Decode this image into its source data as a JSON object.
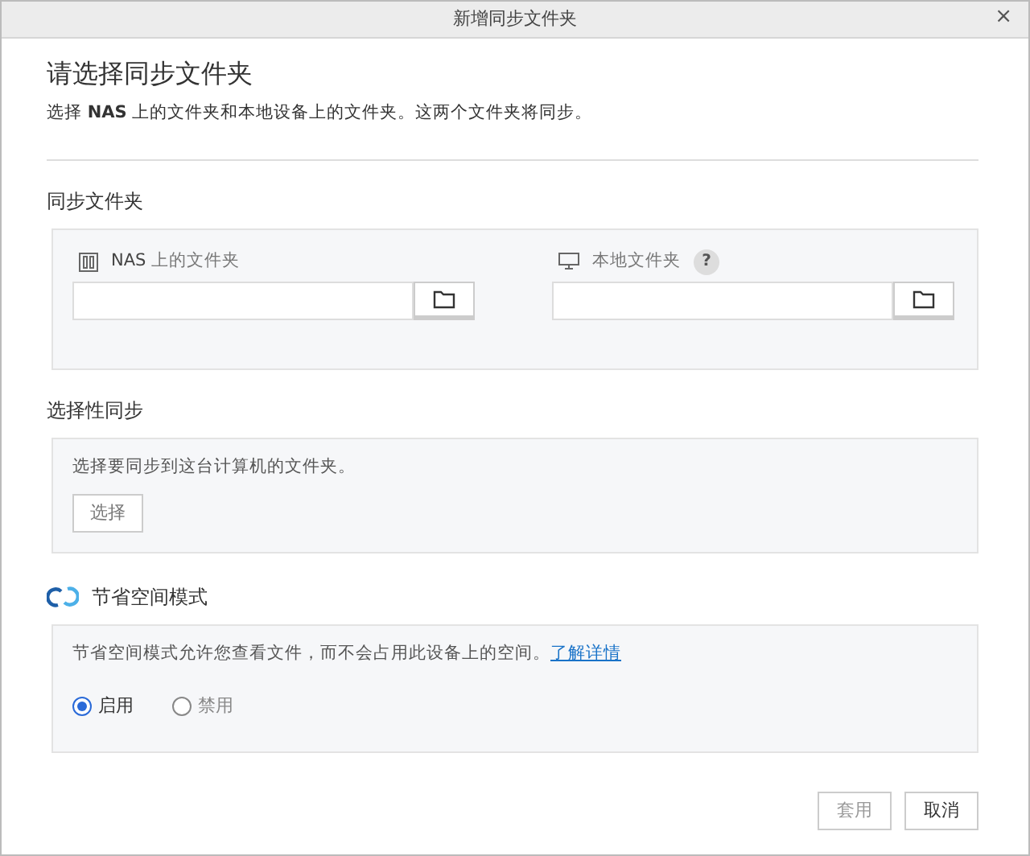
{
  "window": {
    "title": "新增同步文件夹",
    "close": "×"
  },
  "heading": "请选择同步文件夹",
  "subtitle": "选择 **NAS** 上的文件夹和本地设备上的文件夹。这两个文件夹将同步。",
  "sync_folders": {
    "title": "同步文件夹",
    "nas_label": "**NAS** 上的文件夹",
    "local_label": "本地文件夹",
    "help": "?"
  },
  "selective_sync": {
    "title": "选择性同步",
    "description": "选择要同步到这台计算机的文件夹。",
    "button": "选择"
  },
  "space_saving": {
    "title": "节省空间模式",
    "description": "节省空间模式允许您查看文件，而不会占用此设备上的空间。",
    "link": "了解详情",
    "options": [
      {
        "label": "启用",
        "selected": true
      },
      {
        "label": "禁用",
        "selected": false
      }
    ]
  },
  "buttons": [
    {
      "label": "套用",
      "disabled": true
    },
    {
      "label": "取消",
      "disabled": false
    }
  ]
}
